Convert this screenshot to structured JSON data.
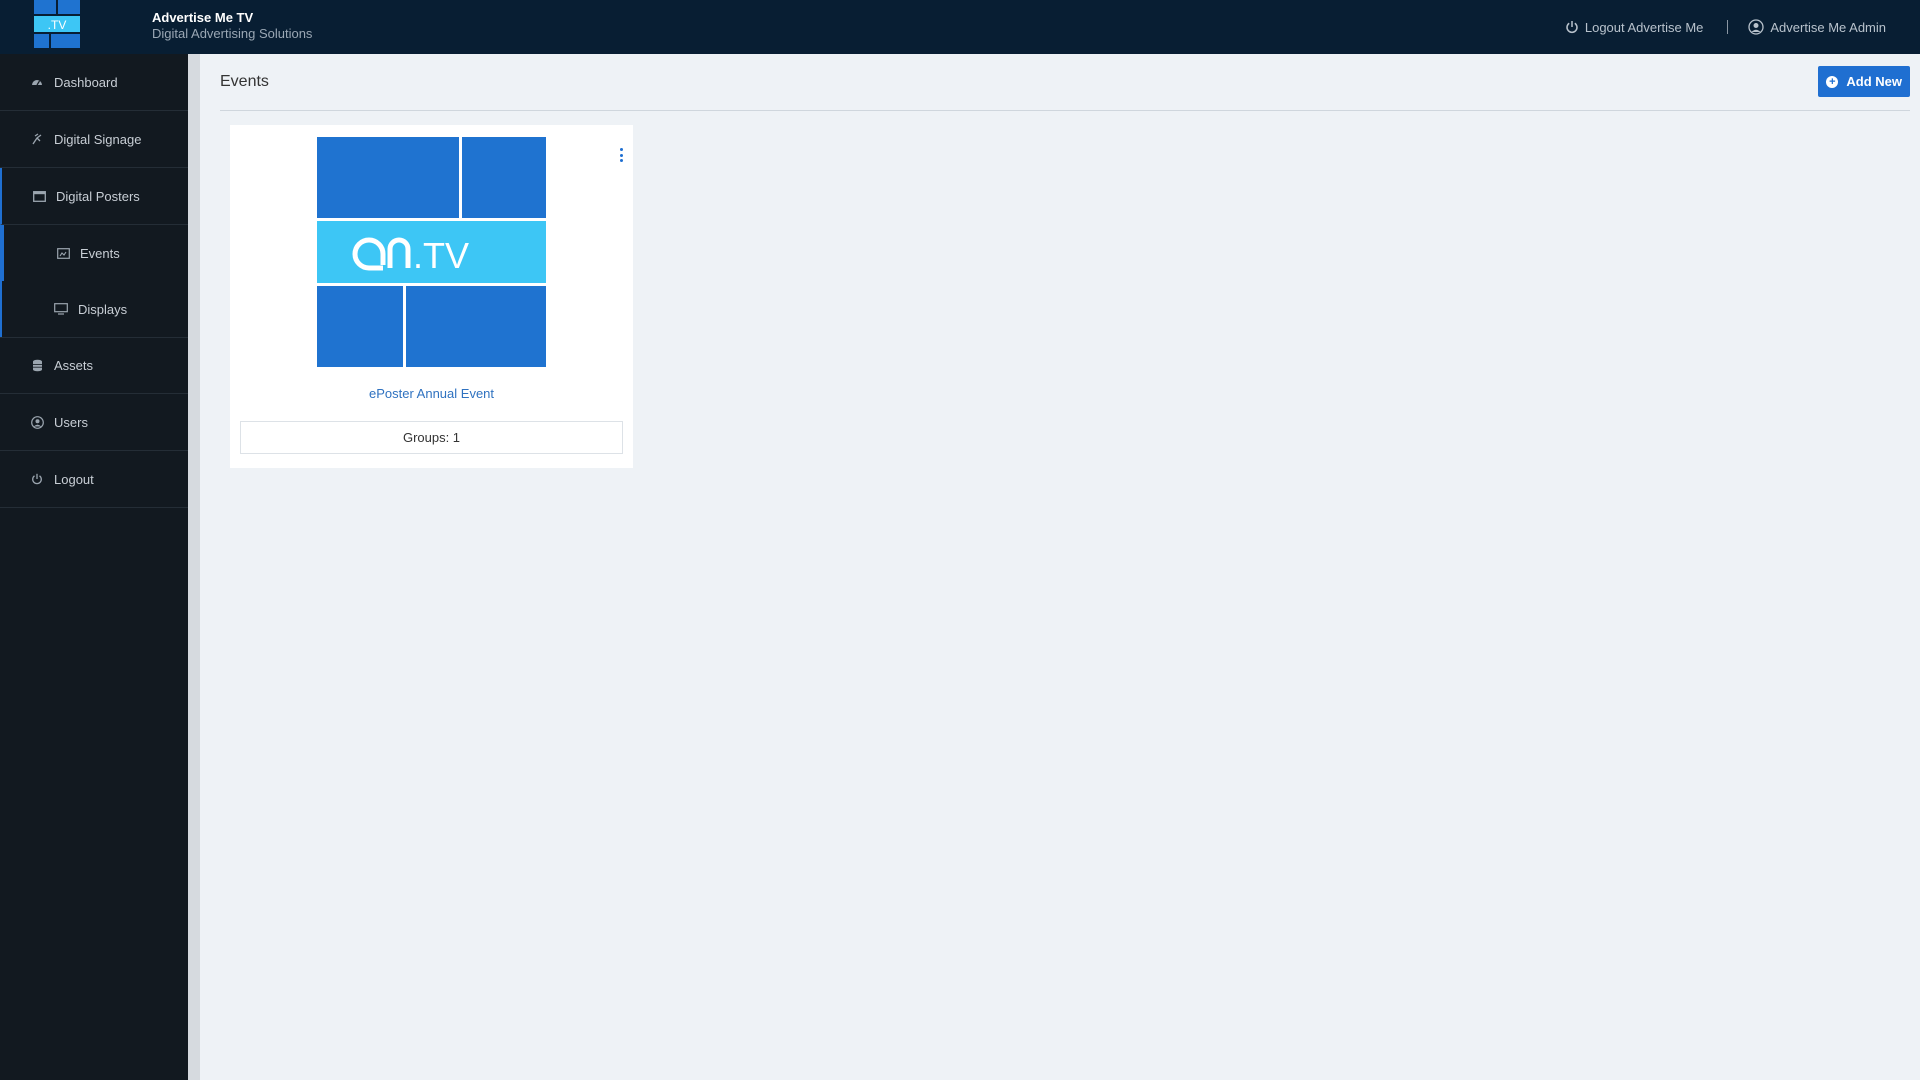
{
  "header": {
    "brand_name": "Advertise Me TV",
    "brand_sub": "Digital Advertising Solutions",
    "logo_text": ".TV",
    "logout_label": "Logout Advertise Me",
    "user_label": "Advertise Me Admin"
  },
  "sidebar": {
    "items": [
      {
        "label": "Dashboard",
        "icon": "dashboard-icon"
      },
      {
        "label": "Digital Signage",
        "icon": "signage-icon"
      },
      {
        "label": "Digital Posters",
        "icon": "poster-icon"
      },
      {
        "label": "Events",
        "icon": "events-icon"
      },
      {
        "label": "Displays",
        "icon": "monitor-icon"
      },
      {
        "label": "Assets",
        "icon": "database-icon"
      },
      {
        "label": "Users",
        "icon": "user-circle-icon"
      },
      {
        "label": "Logout",
        "icon": "power-icon"
      }
    ]
  },
  "main": {
    "title": "Events",
    "add_button": "Add New"
  },
  "events": [
    {
      "name": "ePoster Annual Event",
      "groups": "Groups: 1",
      "thumb_text": ".TV"
    }
  ],
  "colors": {
    "topbar": "#081e33",
    "sidebar": "#121920",
    "accent": "#1f6fd1",
    "tile_dark": "#1f73d0",
    "tile_light": "#3dc6f5"
  }
}
